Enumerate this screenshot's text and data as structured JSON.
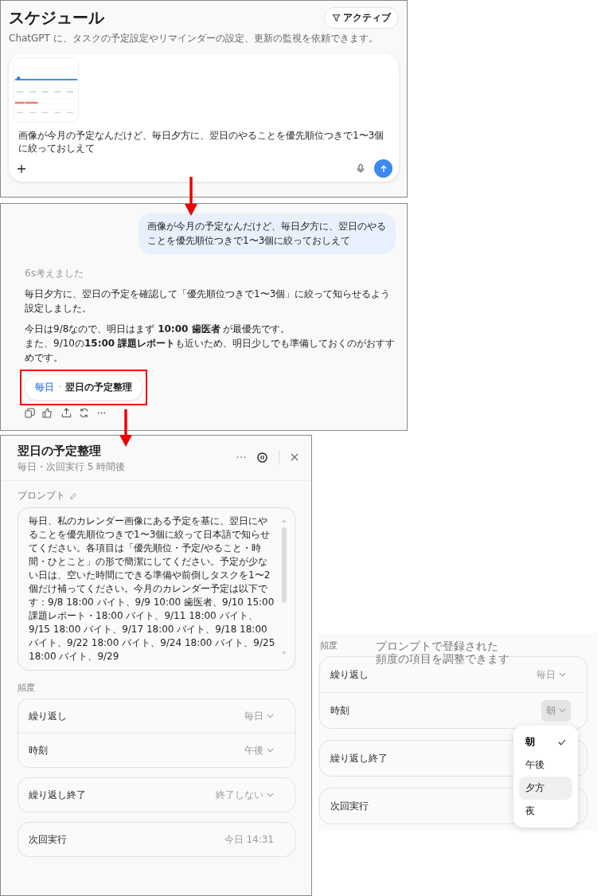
{
  "schedule_panel": {
    "title": "スケジュール",
    "filter_button": "アクティブ",
    "description": "ChatGPT に、タスクの予定設定やリマインダーの設定、更新の監視を依頼できます。",
    "composer": {
      "text": "画像が今月の予定なんだけど、毎日夕方に、翌日のやることを優先順位つきで1〜3個に絞っておしえて"
    }
  },
  "chat_panel": {
    "user_message": "画像が今月の予定なんだけど、毎日夕方に、翌日のやることを優先順位つきで1〜3個に絞っておしえて",
    "thinking_label": "6s考えました",
    "paragraphs": [
      [
        "毎日夕方に、翌日の予定を確認して「優先順位つきで1〜3個」に絞って知らせるよう設定しました。"
      ],
      [
        "今日は9/8なので、明日はまず **10:00 歯医者** が最優先です。",
        "また、9/10の**15:00 課題レポート**も近いため、明日少しでも準備しておくのがおすすめです。"
      ]
    ],
    "task_chip": {
      "frequency": "毎日",
      "separator": "·",
      "title": "翌日の予定整理",
      "highlighted": true
    }
  },
  "task_panel": {
    "title": "翌日の予定整理",
    "subtitle": "毎日・次回実行 5 時間後",
    "prompt_label": "プロンプト",
    "prompt_text": "毎日、私のカレンダー画像にある予定を基に、翌日にやることを優先順位つきで1〜3個に絞って日本語で知らせてください。各項目は「優先順位・予定/やること・時間・ひとこと」の形で簡潔にしてください。予定が少ない日は、空いた時間にできる準備や前倒しタスクを1〜2個だけ補ってください。今月のカレンダー予定は以下です：9/8 18:00 バイト、9/9 10:00 歯医者、9/10 15:00 課題レポート・18:00 バイト、9/11 18:00 バイト、9/15 18:00 バイト、9/17 18:00 バイト、9/18 18:00 バイト、9/22 18:00 バイト、9/24 18:00 バイト、9/25 18:00 バイト、9/29",
    "frequency_label": "頻度",
    "groups": [
      [
        {
          "label": "繰り返し",
          "value": "毎日",
          "kind": "dropdown",
          "open": false
        },
        {
          "label": "時刻",
          "value": "午後",
          "kind": "dropdown",
          "open": false
        }
      ],
      [
        {
          "label": "繰り返し終了",
          "value": "終了しない",
          "kind": "dropdown",
          "open": false
        }
      ],
      [
        {
          "label": "次回実行",
          "value": "今日 14:31",
          "kind": "info"
        }
      ]
    ]
  },
  "dropdown_panel": {
    "annotation": [
      "プロンプトで登録された",
      "頻度の項目を調整できます"
    ],
    "frequency_label": "頻度",
    "groups": [
      [
        {
          "label": "繰り返し",
          "value": "毎日",
          "kind": "dropdown",
          "open": false
        },
        {
          "label": "時刻",
          "value": "朝",
          "kind": "dropdown",
          "open": true
        }
      ],
      [
        {
          "label": "繰り返し終了"
        }
      ],
      [
        {
          "label": "次回実行"
        }
      ]
    ],
    "menu": [
      {
        "label": "朝",
        "selected": true,
        "hovered": false
      },
      {
        "label": "午後",
        "selected": false,
        "hovered": false
      },
      {
        "label": "夕方",
        "selected": false,
        "hovered": true
      },
      {
        "label": "夜",
        "selected": false,
        "hovered": false
      }
    ]
  }
}
